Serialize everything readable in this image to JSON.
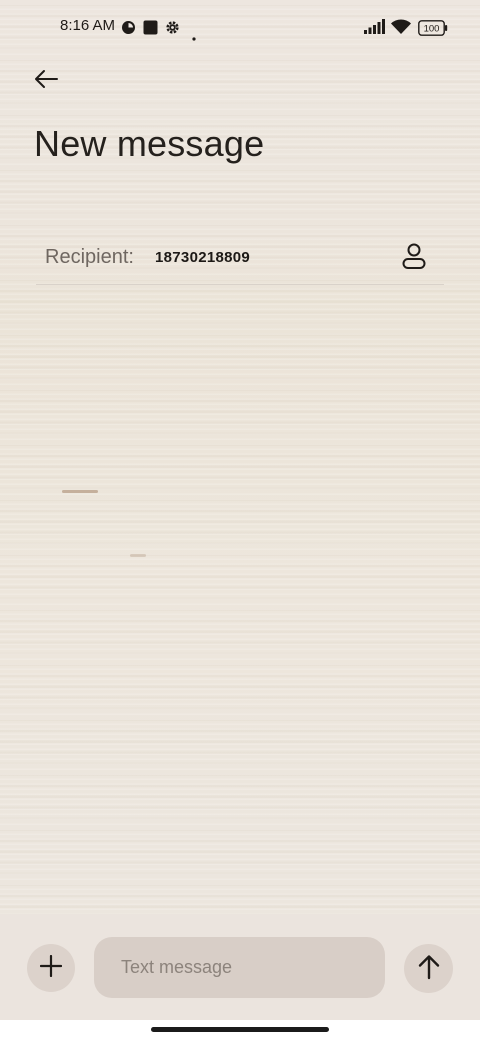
{
  "status_bar": {
    "time": "8:16 AM",
    "battery": "100",
    "icons": [
      "data-saver-icon",
      "square-app-icon",
      "settings-gear-icon",
      "notification-dot-icon",
      "signal-icon",
      "wifi-icon",
      "battery-icon"
    ]
  },
  "header": {
    "back_icon": "arrow-left-icon",
    "title": "New message"
  },
  "recipient": {
    "label": "Recipient:",
    "value": "18730218809",
    "contact_icon": "person-icon"
  },
  "composer": {
    "add_icon": "plus-icon",
    "placeholder": "Text message",
    "value": "",
    "send_icon": "arrow-up-icon"
  },
  "colors": {
    "background": "#efe9e3",
    "button_fill": "#dcd2cb",
    "input_fill": "#d8cec7",
    "text_primary": "#1f1b18",
    "text_secondary": "#6f6761"
  }
}
